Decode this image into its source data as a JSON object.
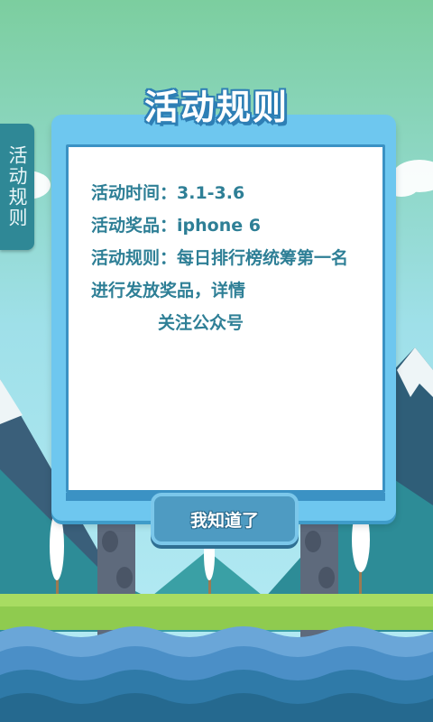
{
  "side_tab": {
    "label": "活动规则"
  },
  "dialog": {
    "title": "活动规则",
    "lines": [
      "活动时间：3.1-3.6",
      "活动奖品：iphone 6",
      "活动规则：每日排行榜统筹第一名进行发放奖品，详情",
      "关注公众号"
    ],
    "confirm_label": "我知道了"
  },
  "colors": {
    "sky": "#7fd0a8",
    "board": "#6ec7ef",
    "text": "#2e7f96",
    "button": "#4e9bc2",
    "grass": "#9bd55a",
    "water": "#3a8fb0"
  }
}
